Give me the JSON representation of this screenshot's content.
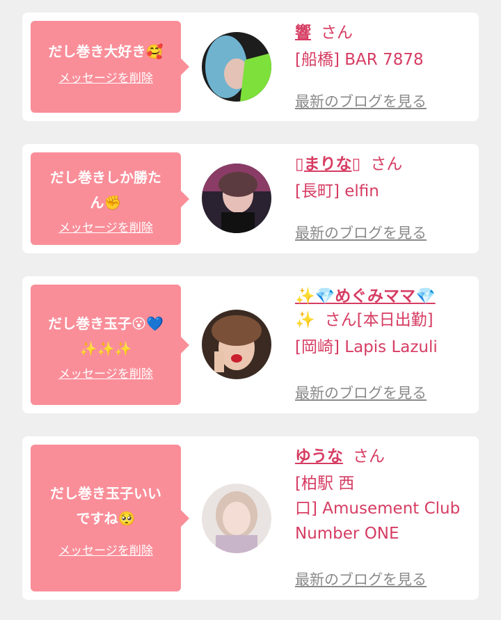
{
  "delete_label": "メッセージを削除",
  "blog_label": "最新のブログを見る",
  "honorific": "さん",
  "cards": [
    {
      "message": "だし巻き大好き🥰",
      "name": "響",
      "place": "[船橋] BAR 7878"
    },
    {
      "message_line1": "だし巻きしか勝た",
      "message_line2": "ん✊",
      "name": "▯まりな▯",
      "place": "[長町] elfin"
    },
    {
      "message_line1": "だし巻き玉子😮💙",
      "message_line2": "✨✨✨",
      "name_line1": "✨💎めぐみママ💎",
      "name_line2_prefix": "✨",
      "name_suffix": "さん[本日出勤]",
      "place": "[岡崎] Lapis Lazuli"
    },
    {
      "message_line1": "だし巻き玉子いい",
      "message_line2": "ですね🥺",
      "name": "ゆうな",
      "place_line1": "[柏駅 西",
      "place_line2": "口] Amusement Club",
      "place_line3": "Number ONE"
    }
  ],
  "colors": {
    "accent": "#d63c62",
    "bubble": "#f98e99",
    "muted": "#8a8a8a",
    "background": "#efefef"
  }
}
